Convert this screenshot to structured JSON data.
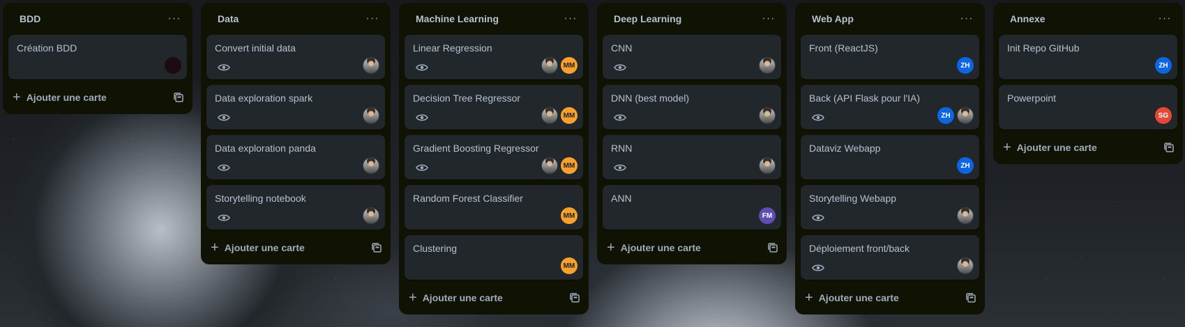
{
  "lists": [
    {
      "title": "BDD",
      "cards": [
        {
          "title": "Création BDD",
          "watch": false,
          "members": [
            "dark"
          ]
        }
      ]
    },
    {
      "title": "Data",
      "cards": [
        {
          "title": "Convert initial data",
          "watch": true,
          "members": [
            "photo"
          ]
        },
        {
          "title": "Data exploration spark",
          "watch": true,
          "members": [
            "photo"
          ]
        },
        {
          "title": "Data exploration panda",
          "watch": true,
          "members": [
            "photo"
          ]
        },
        {
          "title": "Storytelling notebook",
          "watch": true,
          "members": [
            "photo"
          ]
        }
      ]
    },
    {
      "title": "Machine Learning",
      "cards": [
        {
          "title": "Linear Regression",
          "watch": true,
          "members": [
            "photo",
            "MM"
          ]
        },
        {
          "title": "Decision Tree Regressor",
          "watch": true,
          "members": [
            "photo",
            "MM"
          ]
        },
        {
          "title": "Gradient Boosting Regressor",
          "watch": true,
          "members": [
            "photo",
            "MM"
          ]
        },
        {
          "title": "Random Forest Classifier",
          "watch": false,
          "members": [
            "MM"
          ]
        },
        {
          "title": "Clustering",
          "watch": false,
          "members": [
            "MM"
          ]
        }
      ]
    },
    {
      "title": "Deep Learning",
      "cards": [
        {
          "title": "CNN",
          "watch": true,
          "members": [
            "photo"
          ]
        },
        {
          "title": "DNN (best model)",
          "watch": true,
          "members": [
            "photo"
          ]
        },
        {
          "title": "RNN",
          "watch": true,
          "members": [
            "photo"
          ]
        },
        {
          "title": "ANN",
          "watch": false,
          "members": [
            "FM"
          ]
        }
      ]
    },
    {
      "title": "Web App",
      "cards": [
        {
          "title": "Front (ReactJS)",
          "watch": false,
          "members": [
            "ZH"
          ]
        },
        {
          "title": "Back (API Flask pour l'IA)",
          "watch": true,
          "members": [
            "ZH",
            "photo"
          ]
        },
        {
          "title": "Dataviz Webapp",
          "watch": false,
          "members": [
            "ZH"
          ]
        },
        {
          "title": "Storytelling Webapp",
          "watch": true,
          "members": [
            "photo"
          ]
        },
        {
          "title": "Déploiement front/back",
          "watch": true,
          "members": [
            "photo"
          ]
        }
      ]
    },
    {
      "title": "Annexe",
      "cards": [
        {
          "title": "Init Repo GitHub",
          "watch": false,
          "members": [
            "ZH"
          ]
        },
        {
          "title": "Powerpoint",
          "watch": false,
          "members": [
            "SG"
          ]
        }
      ]
    }
  ],
  "add_card_label": "Ajouter une carte",
  "menu_icon": "ellipsis-icon",
  "colors": {
    "list_bg": "#101204",
    "card_bg": "#22272b",
    "text": "#b6c2cf",
    "zh": "#0c66e4",
    "mm": "#f8a12d",
    "fm": "#5e4db2",
    "sg": "#e34935"
  }
}
